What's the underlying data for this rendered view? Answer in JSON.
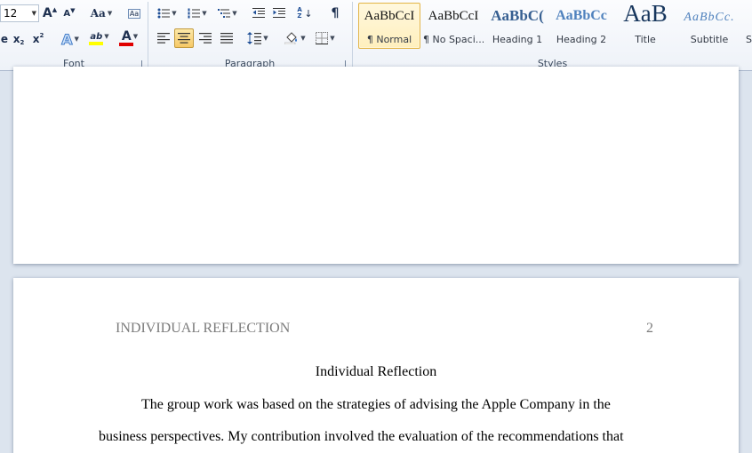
{
  "font_group": {
    "label": "Font",
    "font_size": "12",
    "grow_font": "A",
    "shrink_font": "A",
    "change_case": "Aa",
    "subscript": "x",
    "subscript_digit": "2",
    "superscript": "x",
    "superscript_digit": "2",
    "text_effects": "A",
    "highlight": "ab",
    "font_color": "A",
    "clear_formatting": "Aa"
  },
  "paragraph_group": {
    "label": "Paragraph",
    "sort": "A Z",
    "pilcrow": "¶"
  },
  "styles_group": {
    "label": "Styles",
    "styles": [
      {
        "sample": "AaBbCcI",
        "name": "¶ Normal"
      },
      {
        "sample": "AaBbCcI",
        "name": "¶ No Spaci..."
      },
      {
        "sample": "AaBbC(",
        "name": "Heading 1"
      },
      {
        "sample": "AaBbCc",
        "name": "Heading 2"
      },
      {
        "sample": "AaB",
        "name": "Title"
      },
      {
        "sample": "AaBbCc.",
        "name": "Subtitle"
      },
      {
        "sample": "",
        "name": "S"
      }
    ]
  },
  "document": {
    "running_head": "INDIVIDUAL REFLECTION",
    "page_number": "2",
    "title": "Individual Reflection",
    "lines": [
      "The group work was based on the strategies of advising the Apple Company in the",
      "business perspectives. My contribution involved the evaluation of the recommendations that"
    ]
  },
  "colors": {
    "accent_gold": "#e3b64b",
    "heading_blue": "#365f91",
    "heading2_blue": "#4f81bd",
    "highlight_yellow": "#ffff00",
    "font_red": "#e00000"
  }
}
